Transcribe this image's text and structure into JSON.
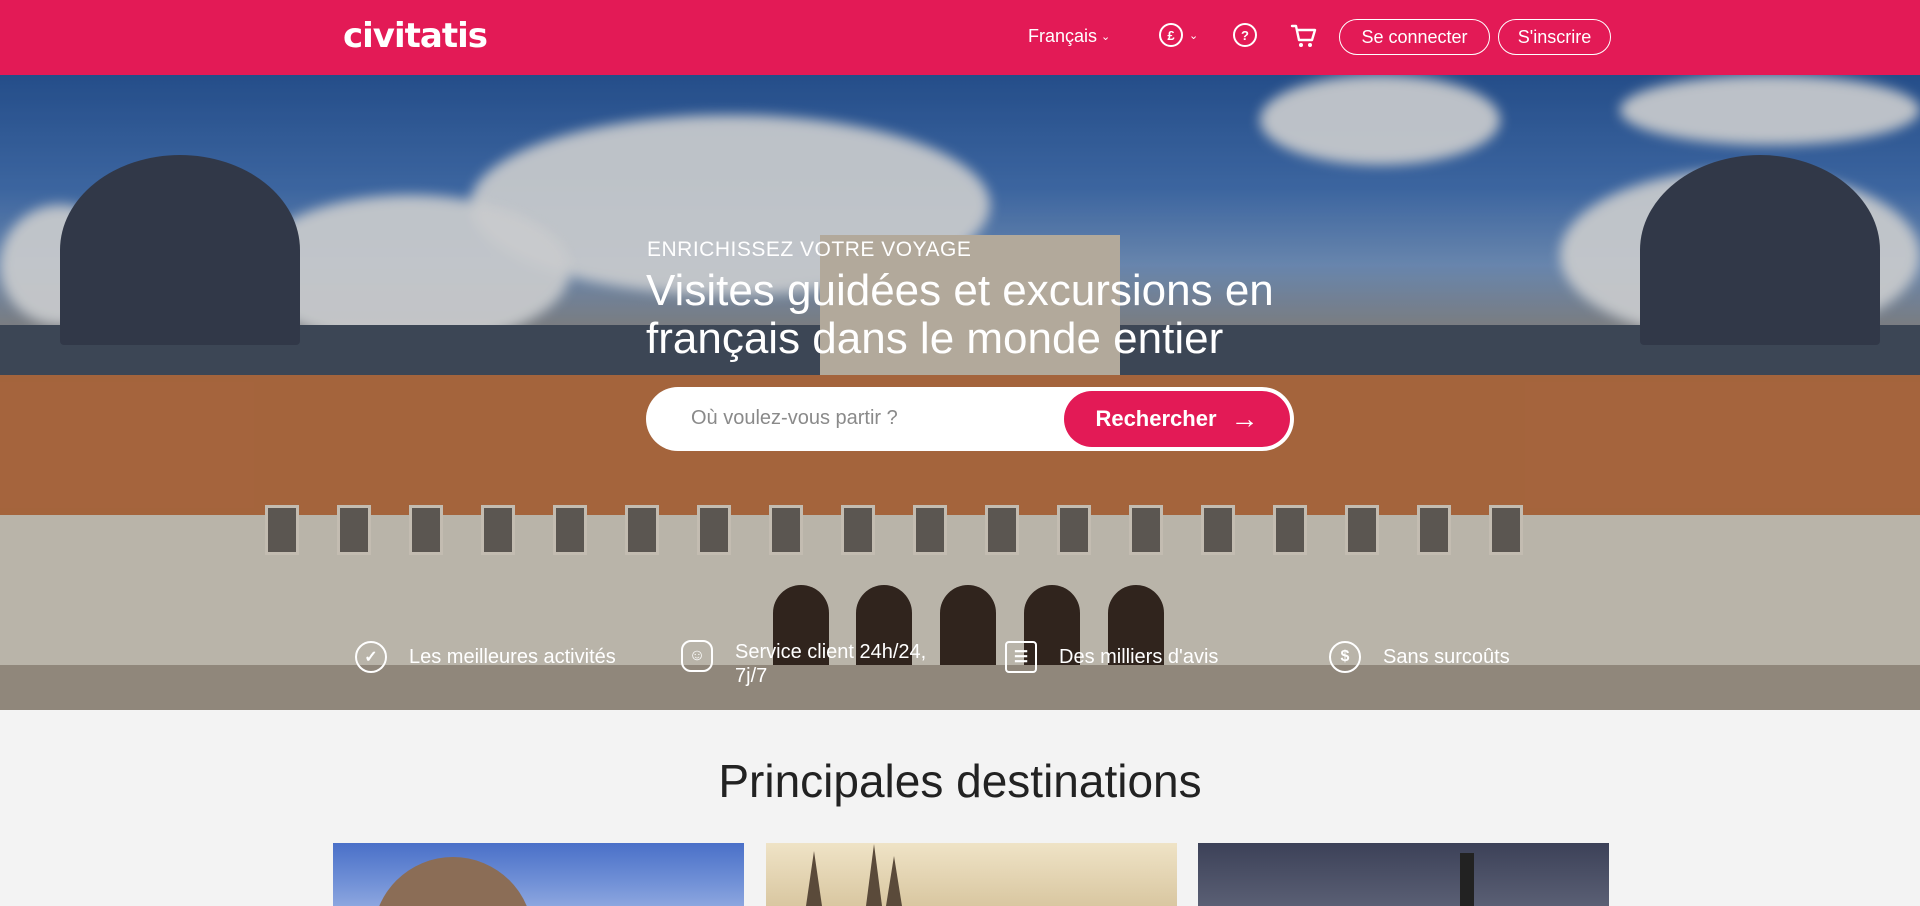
{
  "header": {
    "logo": "civitatis",
    "language": "Français",
    "currency_symbol": "£",
    "login_label": "Se connecter",
    "signup_label": "S'inscrire"
  },
  "hero": {
    "eyebrow": "ENRICHISSEZ VOTRE VOYAGE",
    "title": "Visites guidées et excursions en français dans le monde entier",
    "search": {
      "placeholder": "Où voulez-vous partir ?",
      "button_label": "Rechercher"
    },
    "features": [
      {
        "icon": "badge-check-icon",
        "label": "Les meilleures activités"
      },
      {
        "icon": "support-agent-icon",
        "label": "Service client 24h/24, 7j/7"
      },
      {
        "icon": "reviews-icon",
        "label": "Des milliers d'avis"
      },
      {
        "icon": "dollar-icon",
        "label": "Sans surcoûts"
      }
    ]
  },
  "destinations": {
    "title": "Principales destinations",
    "cards": [
      {
        "image": "colosseum-image"
      },
      {
        "image": "cathedral-city-image"
      },
      {
        "image": "big-ben-image"
      }
    ]
  },
  "colors": {
    "brand": "#e31a56",
    "page_background": "#f3f3f3"
  }
}
